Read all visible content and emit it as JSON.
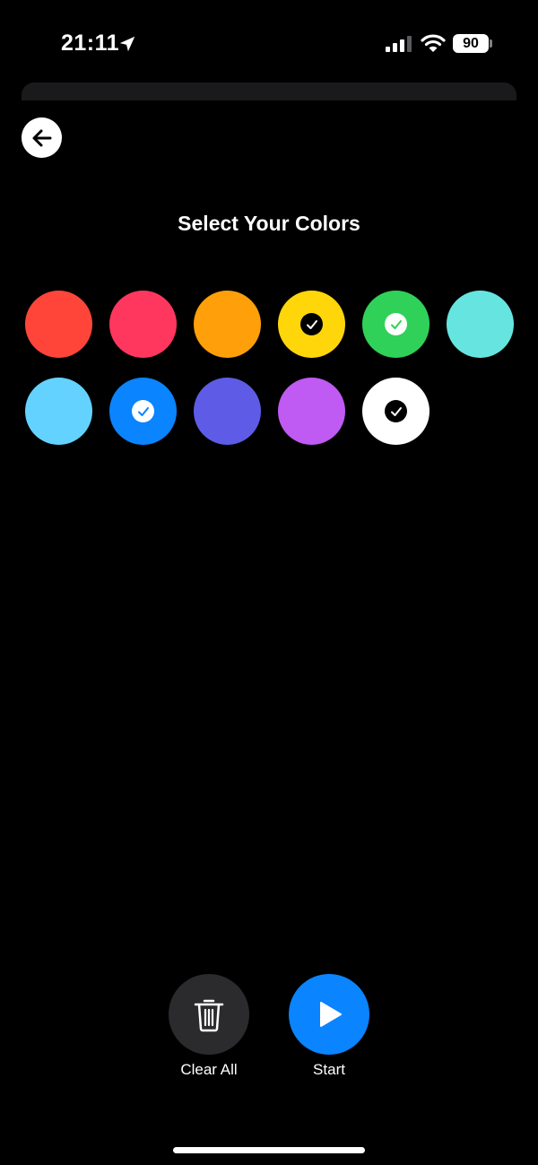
{
  "status_bar": {
    "time": "21:11",
    "battery": "90"
  },
  "header": {
    "title": "Select Your Colors"
  },
  "colors": [
    {
      "name": "red",
      "hex": "#ff453a",
      "selected": false
    },
    {
      "name": "pink",
      "hex": "#ff375f",
      "selected": false
    },
    {
      "name": "orange",
      "hex": "#ff9f0a",
      "selected": false
    },
    {
      "name": "yellow",
      "hex": "#ffd60a",
      "selected": true,
      "check_bg": "#000000",
      "check_color": "#ffffff"
    },
    {
      "name": "green",
      "hex": "#30d158",
      "selected": true,
      "check_bg": "#ffffff",
      "check_color": "#30d158"
    },
    {
      "name": "teal",
      "hex": "#66e4e0",
      "selected": false
    },
    {
      "name": "light-blue",
      "hex": "#64d2ff",
      "selected": false
    },
    {
      "name": "blue",
      "hex": "#0a84ff",
      "selected": true,
      "check_bg": "#ffffff",
      "check_color": "#0a84ff"
    },
    {
      "name": "indigo",
      "hex": "#5e5ce6",
      "selected": false
    },
    {
      "name": "purple",
      "hex": "#bf5af2",
      "selected": false
    },
    {
      "name": "white",
      "hex": "#ffffff",
      "selected": true,
      "check_bg": "#000000",
      "check_color": "#ffffff"
    }
  ],
  "actions": {
    "clear_label": "Clear All",
    "start_label": "Start"
  },
  "theme": {
    "background": "#000000",
    "accent": "#0a84ff",
    "secondary_button": "#2b2b2d"
  }
}
